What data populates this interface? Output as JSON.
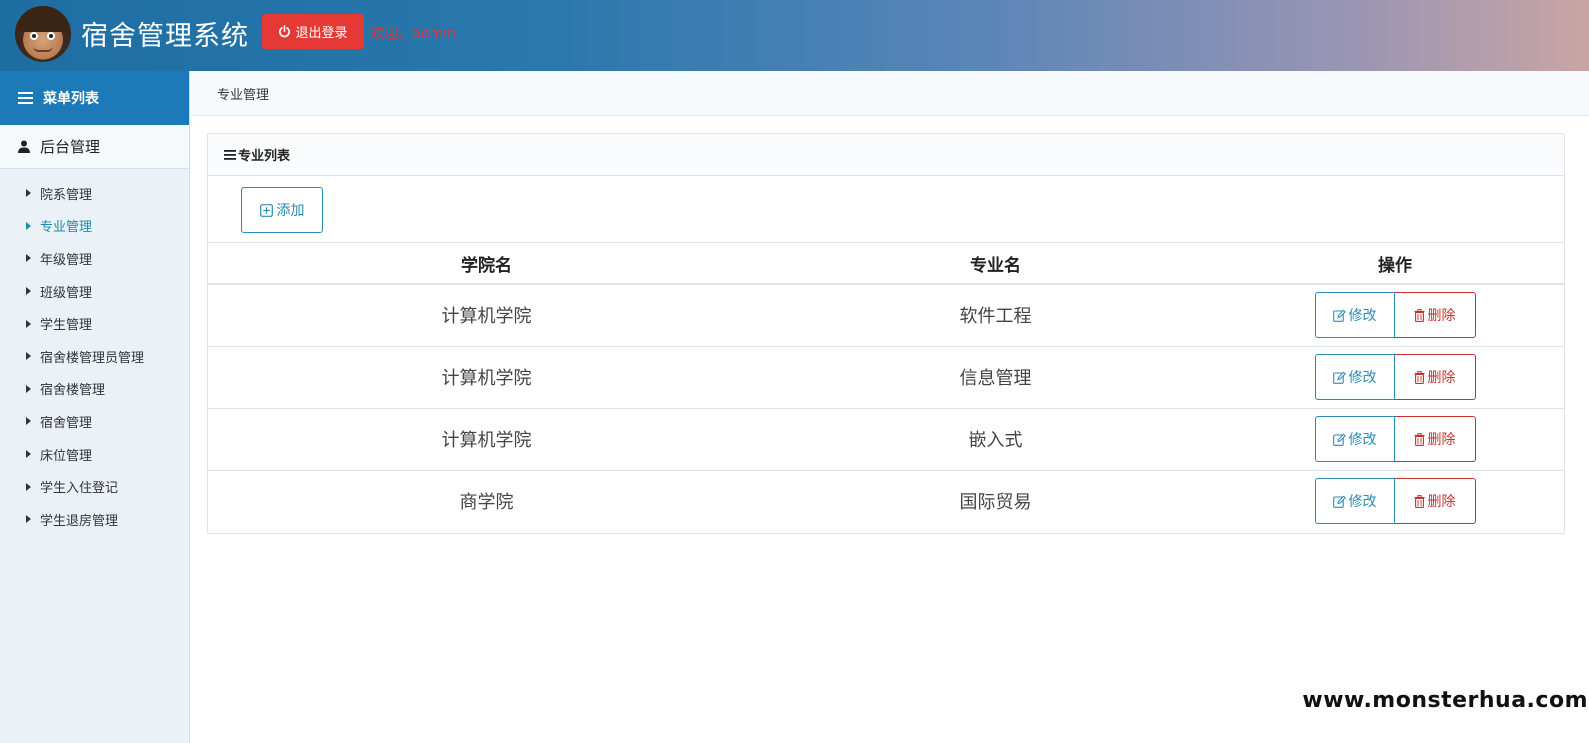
{
  "header": {
    "app_title": "宿舍管理系统",
    "logout_label": "退出登录",
    "welcome": "欢迎，admin"
  },
  "sidebar": {
    "menu_title": "菜单列表",
    "section_title": "后台管理",
    "items": [
      {
        "label": "院系管理",
        "active": false
      },
      {
        "label": "专业管理",
        "active": true
      },
      {
        "label": "年级管理",
        "active": false
      },
      {
        "label": "班级管理",
        "active": false
      },
      {
        "label": "学生管理",
        "active": false
      },
      {
        "label": "宿舍楼管理员管理",
        "active": false
      },
      {
        "label": "宿舍楼管理",
        "active": false
      },
      {
        "label": "宿舍管理",
        "active": false
      },
      {
        "label": "床位管理",
        "active": false
      },
      {
        "label": "学生入住登记",
        "active": false
      },
      {
        "label": "学生退房管理",
        "active": false
      }
    ]
  },
  "breadcrumb": "专业管理",
  "panel": {
    "title": "专业列表",
    "add_label": "添加",
    "columns": [
      "学院名",
      "专业名",
      "操作"
    ],
    "rows": [
      {
        "college": "计算机学院",
        "major": "软件工程"
      },
      {
        "college": "计算机学院",
        "major": "信息管理"
      },
      {
        "college": "计算机学院",
        "major": "嵌入式"
      },
      {
        "college": "商学院",
        "major": "国际贸易"
      }
    ],
    "edit_label": "修改",
    "delete_label": "删除"
  },
  "watermark": "www.monsterhua.com",
  "colors": {
    "accent": "#2b8bb5",
    "danger": "#e53935",
    "active_nav": "#1e8aa8"
  }
}
